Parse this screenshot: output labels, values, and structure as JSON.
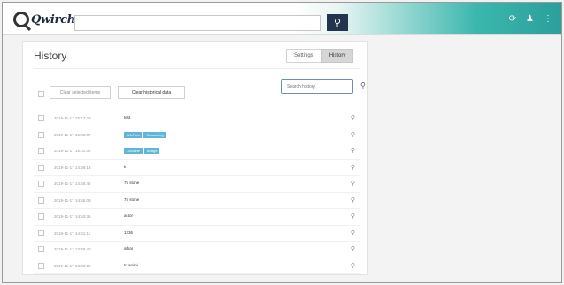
{
  "header": {
    "logo_text": "Qwirch",
    "search_value": "",
    "icons": [
      "refresh-icon",
      "user-icon",
      "more-icon"
    ]
  },
  "history": {
    "title": "History",
    "tabs": [
      {
        "label": "Settings",
        "active": false
      },
      {
        "label": "History",
        "active": true
      }
    ],
    "clear_selected_label": "Clear selected items",
    "clear_all_label": "Clear historical data",
    "search_placeholder": "Search history",
    "rows": [
      {
        "date": "2019-11-17 15:12:28",
        "terms": [
          "test"
        ],
        "tags": false
      },
      {
        "date": "2019-11-17 15:05:07",
        "terms": [
          "WizFind",
          "Reasoning"
        ],
        "tags": true
      },
      {
        "date": "2019-11-17 15:01:02",
        "terms": [
          "Lucoline",
          "Bridge"
        ],
        "tags": true
      },
      {
        "date": "2019-11-17 14:58:13",
        "terms": [
          "k"
        ],
        "tags": false
      },
      {
        "date": "2019-11-17 14:56:42",
        "terms": [
          "75 stone"
        ],
        "tags": false
      },
      {
        "date": "2019-11-17 14:55:09",
        "terms": [
          "75 stone"
        ],
        "tags": false
      },
      {
        "date": "2019-11-17 14:53:35",
        "terms": [
          "actor"
        ],
        "tags": false
      },
      {
        "date": "2019-11-17 14:51:11",
        "terms": [
          "1236"
        ],
        "tags": false
      },
      {
        "date": "2019-11-17 13:46:40",
        "terms": [
          "athar"
        ],
        "tags": false
      },
      {
        "date": "2019-11-17 13:38:26",
        "terms": [
          "to animi"
        ],
        "tags": false
      }
    ]
  }
}
